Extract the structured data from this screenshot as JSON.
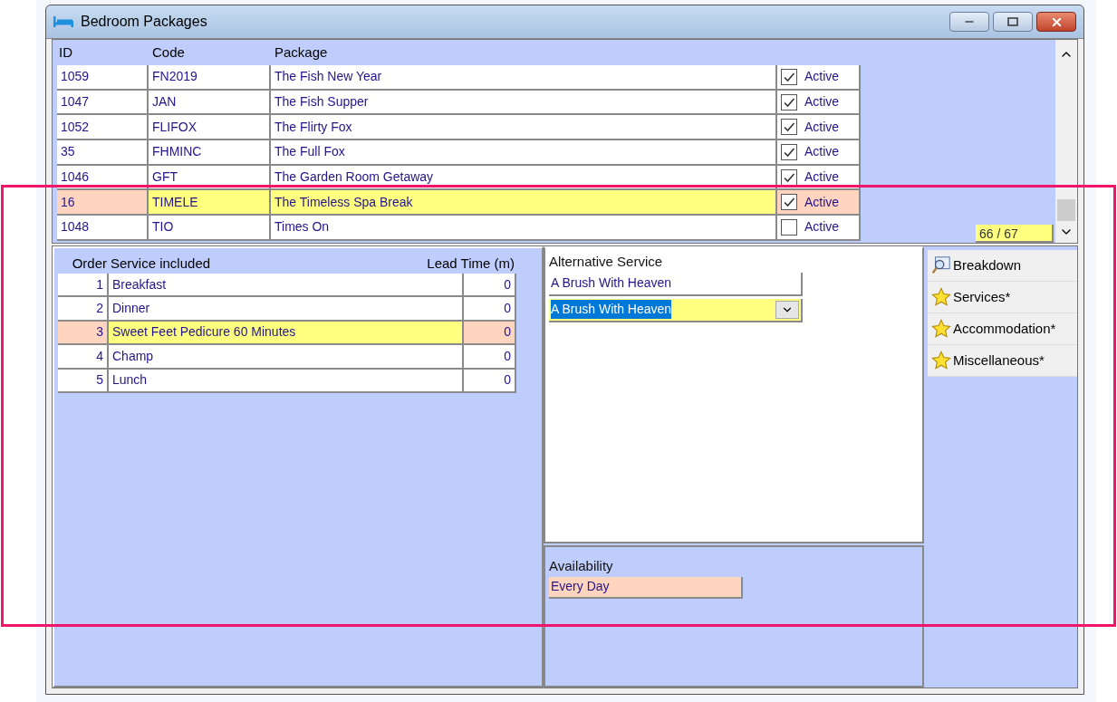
{
  "window": {
    "title": "Bedroom Packages"
  },
  "packages": {
    "columns": [
      "ID",
      "Code",
      "Package"
    ],
    "rows": [
      {
        "id": "1059",
        "code": "FN2019",
        "package": "The Fish New Year",
        "active": true,
        "active_label": "Active",
        "selected": false
      },
      {
        "id": "1047",
        "code": "JAN",
        "package": "The Fish Supper",
        "active": true,
        "active_label": "Active",
        "selected": false
      },
      {
        "id": "1052",
        "code": "FLIFOX",
        "package": "The Flirty Fox",
        "active": true,
        "active_label": "Active",
        "selected": false
      },
      {
        "id": "35",
        "code": "FHMINC",
        "package": "The Full Fox",
        "active": true,
        "active_label": "Active",
        "selected": false
      },
      {
        "id": "1046",
        "code": "GFT",
        "package": "The Garden Room Getaway",
        "active": true,
        "active_label": "Active",
        "selected": false
      },
      {
        "id": "16",
        "code": "TIMELE",
        "package": "The Timeless Spa Break",
        "active": true,
        "active_label": "Active",
        "selected": true
      },
      {
        "id": "1048",
        "code": "TIO",
        "package": "Times On",
        "active": false,
        "active_label": "Active",
        "selected": false
      }
    ],
    "counter": "66 / 67"
  },
  "services": {
    "columns": [
      "Order",
      "Service included",
      "Lead Time (m)"
    ],
    "rows": [
      {
        "order": "1",
        "service": "Breakfast",
        "lead_time": "0",
        "selected": false
      },
      {
        "order": "2",
        "service": "Dinner",
        "lead_time": "0",
        "selected": false
      },
      {
        "order": "3",
        "service": "Sweet Feet Pedicure 60 Minutes",
        "lead_time": "0",
        "selected": true
      },
      {
        "order": "4",
        "service": "Champ",
        "lead_time": "0",
        "selected": false
      },
      {
        "order": "5",
        "service": "Lunch",
        "lead_time": "0",
        "selected": false
      }
    ]
  },
  "alternative_service": {
    "label": "Alternative Service",
    "value": "A Brush With Heaven",
    "dropdown_value": "A Brush With Heaven"
  },
  "availability": {
    "label": "Availability",
    "value": "Every Day"
  },
  "side_buttons": [
    {
      "label": "Breakdown",
      "kind": "breakdown"
    },
    {
      "label": "Services*",
      "kind": "star"
    },
    {
      "label": "Accommodation*",
      "kind": "star"
    },
    {
      "label": "Miscellaneous*",
      "kind": "star"
    }
  ]
}
